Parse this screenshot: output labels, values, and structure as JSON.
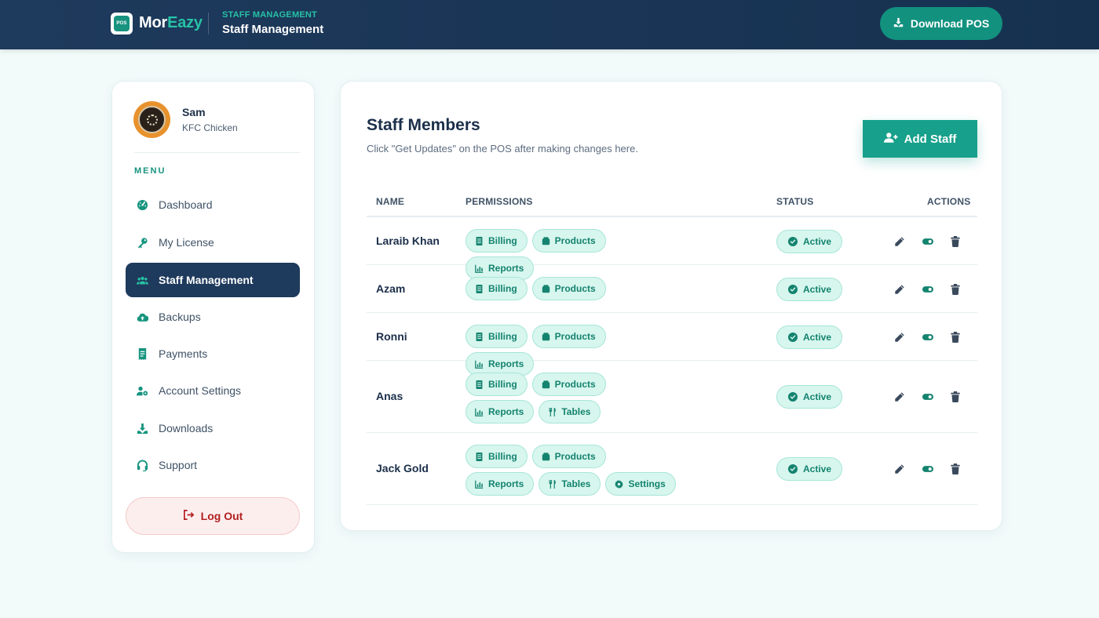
{
  "header": {
    "logo_text": "POS",
    "brand_part1": "Mor",
    "brand_part2": "Eazy",
    "crumb_small": "STAFF MANAGEMENT",
    "crumb_title": "Staff Management",
    "download_label": "Download POS"
  },
  "sidebar": {
    "user_name": "Sam",
    "user_sub": "KFC Chicken",
    "menu_label": "MENU",
    "items": [
      {
        "label": "Dashboard",
        "icon": "gauge-icon",
        "active": false
      },
      {
        "label": "My License",
        "icon": "key-icon",
        "active": false
      },
      {
        "label": "Staff Management",
        "icon": "users-icon",
        "active": true
      },
      {
        "label": "Backups",
        "icon": "cloud-upload-icon",
        "active": false
      },
      {
        "label": "Payments",
        "icon": "receipt-icon",
        "active": false
      },
      {
        "label": "Account Settings",
        "icon": "user-gear-icon",
        "active": false
      },
      {
        "label": "Downloads",
        "icon": "download-icon",
        "active": false
      },
      {
        "label": "Support",
        "icon": "headset-icon",
        "active": false
      }
    ],
    "logout_label": "Log Out"
  },
  "main": {
    "title": "Staff Members",
    "subtitle": "Click \"Get Updates\" on the POS after making changes here.",
    "add_label": "Add Staff",
    "columns": {
      "name": "NAME",
      "permissions": "PERMISSIONS",
      "status": "STATUS",
      "actions": "ACTIONS"
    },
    "rows": [
      {
        "name": "Laraib Khan",
        "permissions": [
          "Billing",
          "Products",
          "Reports"
        ],
        "status": "Active"
      },
      {
        "name": "Azam",
        "permissions": [
          "Billing",
          "Products"
        ],
        "status": "Active"
      },
      {
        "name": "Ronni",
        "permissions": [
          "Billing",
          "Products",
          "Reports"
        ],
        "status": "Active"
      },
      {
        "name": "Anas",
        "permissions": [
          "Billing",
          "Products",
          "Reports",
          "Tables"
        ],
        "status": "Active"
      },
      {
        "name": "Jack Gold",
        "permissions": [
          "Billing",
          "Products",
          "Reports",
          "Tables",
          "Settings"
        ],
        "status": "Active"
      }
    ]
  },
  "colors": {
    "header_bg": "#1e3a5c",
    "accent": "#17a08b",
    "chip_bg": "#d7f6ee",
    "danger": "#b21f1f"
  }
}
